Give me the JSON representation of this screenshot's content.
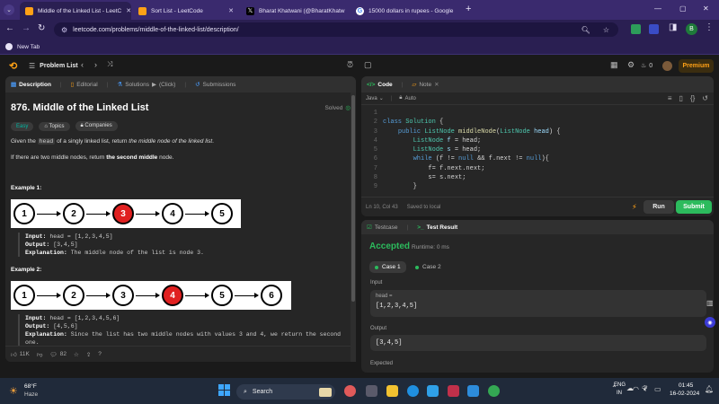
{
  "browser": {
    "tabs": [
      {
        "title": "Middle of the Linked List - LeetC",
        "color": "#ffa116"
      },
      {
        "title": "Sort List - LeetCode",
        "color": "#ffa116"
      },
      {
        "title": "Bharat Khatwani (@BharatKhatw",
        "color": "#000000"
      },
      {
        "title": "15000 dollars in rupees - Google",
        "color": "#4285f4"
      }
    ],
    "new_tab_symbol": "+",
    "url": "leetcode.com/problems/middle-of-the-linked-list/description/",
    "bookmark": "New Tab",
    "window_controls": [
      "—",
      "▢",
      "✕"
    ],
    "profile_initial": "B"
  },
  "lc_nav": {
    "problem_list": "Problem List",
    "premium": "Premium",
    "streak": "0"
  },
  "left_tabs": [
    "Description",
    "Editorial",
    "Solutions",
    "(Click)",
    "Submissions"
  ],
  "problem": {
    "title": "876. Middle of the Linked List",
    "status": "Solved",
    "difficulty": "Easy",
    "chips": [
      "Topics",
      "Companies"
    ],
    "p1_a": "Given the",
    "p1_code": "head",
    "p1_b": "of a singly linked list, return",
    "p1_c": "the middle node of the linked list",
    "p1_d": ".",
    "p2_a": "If there are two middle nodes, return",
    "p2_b": "the second middle",
    "p2_c": "node."
  },
  "examples": [
    {
      "label": "Example 1:",
      "nodes": [
        "1",
        "2",
        "3",
        "4",
        "5"
      ],
      "highlight": 2,
      "input_label": "Input:",
      "input": "head = [1,2,3,4,5]",
      "output_label": "Output:",
      "output": "[3,4,5]",
      "explanation_label": "Explanation:",
      "explanation": "The middle node of the list is node 3."
    },
    {
      "label": "Example 2:",
      "nodes": [
        "1",
        "2",
        "3",
        "4",
        "5",
        "6"
      ],
      "highlight": 3,
      "input_label": "Input:",
      "input": "head = [1,2,3,4,5,6]",
      "output_label": "Output:",
      "output": "[4,5,6]",
      "explanation_label": "Explanation:",
      "explanation": "Since the list has two middle nodes with values 3 and 4, we return the second",
      "explanation2": "one."
    }
  ],
  "left_footer": {
    "likes": "11K",
    "comments": "82"
  },
  "code_tabs": [
    "Code",
    "Note"
  ],
  "code_bar": {
    "language": "Java",
    "mode": "Auto"
  },
  "code_lines": [
    {
      "n": "1",
      "html": ""
    },
    {
      "n": "2",
      "html": "<span class='kw'>class</span> <span class='ty'>Solution</span> <span class='pl'>{</span>"
    },
    {
      "n": "3",
      "html": "    <span class='kw'>public</span> <span class='ty'>ListNode</span> <span class='fn'>middleNode</span><span class='pl'>(</span><span class='ty'>ListNode</span> <span class='vr'>head</span><span class='pl'>) {</span>"
    },
    {
      "n": "4",
      "html": "        <span class='ty'>ListNode</span> <span class='vr'>f</span> <span class='pl'>= head;</span>"
    },
    {
      "n": "5",
      "html": "        <span class='ty'>ListNode</span> <span class='vr'>s</span> <span class='pl'>= head;</span>"
    },
    {
      "n": "6",
      "html": "        <span class='kw'>while</span> <span class='pl'>(f != </span><span class='kw'>null</span> <span class='pl'>&amp;&amp; f.next != </span><span class='kw'>null</span><span class='pl'>){</span>"
    },
    {
      "n": "7",
      "html": "            <span class='pl'>f= f.next.next;</span>"
    },
    {
      "n": "8",
      "html": "            <span class='pl'>s= s.next;</span>"
    },
    {
      "n": "9",
      "html": "        <span class='pl'>}</span>"
    }
  ],
  "code_footer": {
    "position": "Ln 10, Col 43",
    "saved": "Saved to local"
  },
  "buttons": {
    "run": "Run",
    "submit": "Submit"
  },
  "result_tabs": [
    "Testcase",
    "Test Result"
  ],
  "result": {
    "status": "Accepted",
    "runtime": "Runtime: 0 ms",
    "cases": [
      "Case 1",
      "Case 2"
    ],
    "input_label": "Input",
    "head_label": "head =",
    "head_value": "[1,2,3,4,5]",
    "output_label": "Output",
    "output_value": "[3,4,5]",
    "expected_label": "Expected"
  },
  "taskbar": {
    "weather_temp": "68°F",
    "weather_desc": "Haze",
    "search": "Search",
    "lang1": "ENG",
    "lang2": "IN",
    "time": "01:45",
    "date": "16-02-2024"
  }
}
